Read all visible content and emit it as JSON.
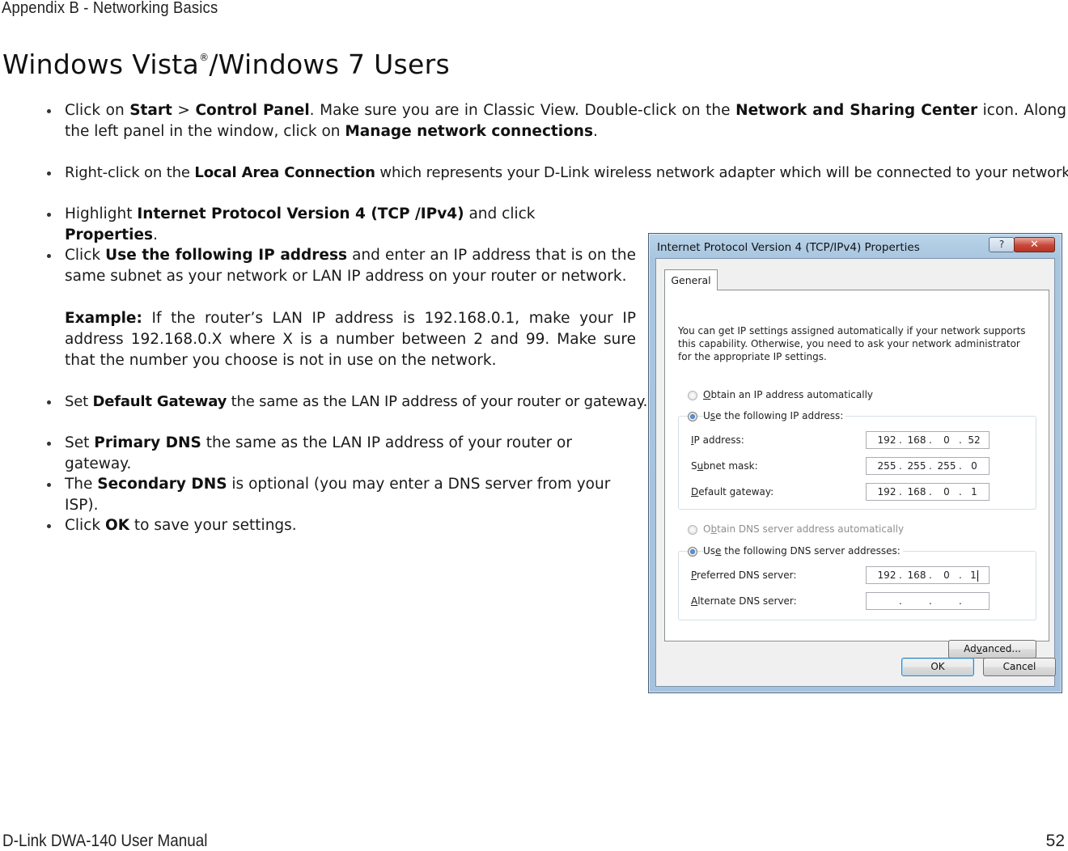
{
  "header": {
    "section": "Appendix B - Networking Basics"
  },
  "title": {
    "main": "Windows Vista",
    "reg": "®",
    "rest": "/Windows 7 Users"
  },
  "steps": [
    {
      "segments": [
        {
          "t": "Click on "
        },
        {
          "t": "Start",
          "b": true
        },
        {
          "t": " > "
        },
        {
          "t": "Control Panel",
          "b": true
        },
        {
          "t": ". Make sure you are in Classic View. Double-click on the "
        },
        {
          "t": "Network and Sharing Center",
          "b": true
        },
        {
          "t": " icon. Along the left panel in the window, click on "
        },
        {
          "t": "Manage network connections",
          "b": true
        },
        {
          "t": "."
        }
      ]
    },
    {
      "segments": [
        {
          "t": "Right-click on the "
        },
        {
          "t": "Local Area Connection",
          "b": true
        },
        {
          "t": " which represents your D-Link wireless network adapter which will be connected to your network."
        }
      ]
    },
    {
      "segments": [
        {
          "t": "Highlight "
        },
        {
          "t": "Internet Protocol Version 4 (TCP /IPv4)",
          "b": true
        },
        {
          "t": " and click "
        },
        {
          "t": "Properties",
          "b": true
        },
        {
          "t": "."
        }
      ]
    },
    {
      "segments": [
        {
          "t": "Click "
        },
        {
          "t": "Use the following IP address",
          "b": true
        },
        {
          "t": " and enter an IP address that is on the same subnet as your network or LAN IP address on your router or network."
        }
      ]
    },
    {
      "segments": [
        {
          "t": "Example:",
          "b": true
        },
        {
          "t": " If the router’s LAN IP address is 192.168.0.1, make your IP address 192.168.0.X where X is a number between 2 and 99. Make sure that the number you choose is not in use on the network."
        }
      ]
    },
    {
      "segments": [
        {
          "t": "Set "
        },
        {
          "t": "Default Gateway",
          "b": true
        },
        {
          "t": " the same as the LAN IP address of your router or gateway."
        }
      ]
    },
    {
      "segments": [
        {
          "t": "Set "
        },
        {
          "t": "Primary DNS",
          "b": true
        },
        {
          "t": " the same as the LAN IP address of your router or gateway."
        }
      ]
    },
    {
      "segments": [
        {
          "t": "The "
        },
        {
          "t": "Secondary DNS",
          "b": true
        },
        {
          "t": " is optional (you may enter a DNS server from your ISP)."
        }
      ]
    },
    {
      "segments": [
        {
          "t": "Click "
        },
        {
          "t": "OK",
          "b": true
        },
        {
          "t": " to save your settings."
        }
      ]
    }
  ],
  "dialog": {
    "title": "Internet Protocol Version 4 (TCP/IPv4) Properties",
    "help": "?",
    "close": "✕",
    "tab": "General",
    "intro": "You can get IP settings assigned automatically if your network supports this capability. Otherwise, you need to ask your network administrator for the appropriate IP settings.",
    "obtain_ip": "Obtain an IP address automatically",
    "use_ip": "Use the following IP address:",
    "ip_label": "IP address:",
    "subnet_label": "Subnet mask:",
    "gateway_label": "Default gateway:",
    "ip": [
      "192",
      "168",
      "0",
      "52"
    ],
    "subnet": [
      "255",
      "255",
      "255",
      "0"
    ],
    "gateway": [
      "192",
      "168",
      "0",
      "1"
    ],
    "obtain_dns": "Obtain DNS server address automatically",
    "use_dns": "Use the following DNS server addresses:",
    "pdns_label": "Preferred DNS server:",
    "adns_label": "Alternate DNS server:",
    "pdns": [
      "192",
      "168",
      "0",
      "1"
    ],
    "adns": [
      "",
      "",
      "",
      ""
    ],
    "advanced": "Advanced...",
    "ok": "OK",
    "cancel": "Cancel"
  },
  "footer": {
    "manual": "D-Link DWA-140 User Manual",
    "page": "52"
  }
}
